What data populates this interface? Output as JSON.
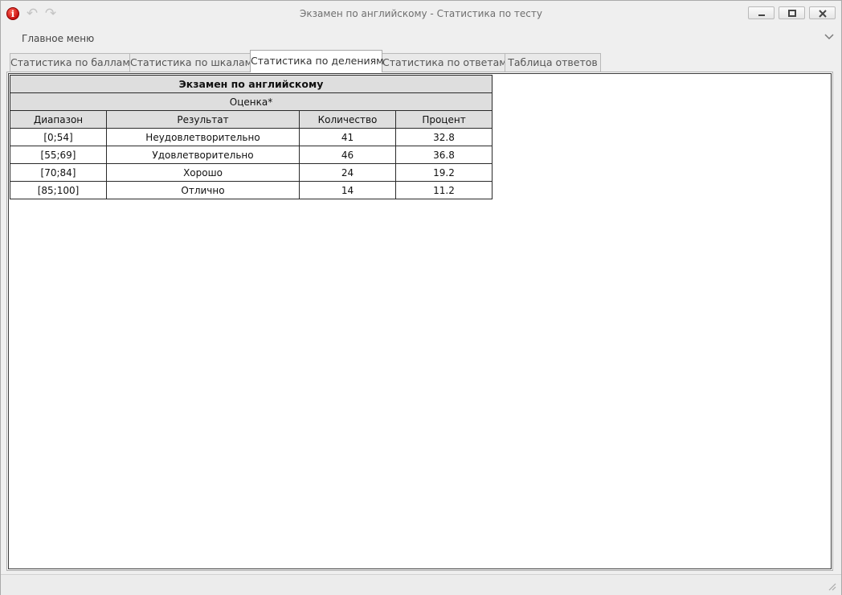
{
  "window": {
    "title": "Экзамен по английскому - Статистика по тесту"
  },
  "menu": {
    "main_label": "Главное меню"
  },
  "tabs": [
    {
      "label": "Статистика по баллам",
      "active": false
    },
    {
      "label": "Статистика по шкалам",
      "active": false
    },
    {
      "label": "Статистика по делениям",
      "active": true
    },
    {
      "label": "Статистика по ответам",
      "active": false
    },
    {
      "label": "Таблица ответов",
      "active": false
    }
  ],
  "table": {
    "title": "Экзамен по английскому",
    "subtitle": "Оценка*",
    "columns": [
      "Диапазон",
      "Результат",
      "Количество",
      "Процент"
    ],
    "rows": [
      [
        "[0;54]",
        "Неудовлетворительно",
        "41",
        "32.8"
      ],
      [
        "[55;69]",
        "Удовлетворительно",
        "46",
        "36.8"
      ],
      [
        "[70;84]",
        "Хорошо",
        "24",
        "19.2"
      ],
      [
        "[85;100]",
        "Отлично",
        "14",
        "11.2"
      ]
    ]
  },
  "icons": {
    "app": "info-icon",
    "undo": "undo-icon",
    "redo": "redo-icon",
    "minimize": "minimize-icon",
    "maximize": "maximize-icon",
    "close": "close-icon",
    "collapse": "chevron-down-icon",
    "grip": "resize-grip-icon"
  },
  "colors": {
    "app_icon": "#d01a10",
    "header_fill": "#dedede",
    "active_tab": "#ffffff"
  }
}
